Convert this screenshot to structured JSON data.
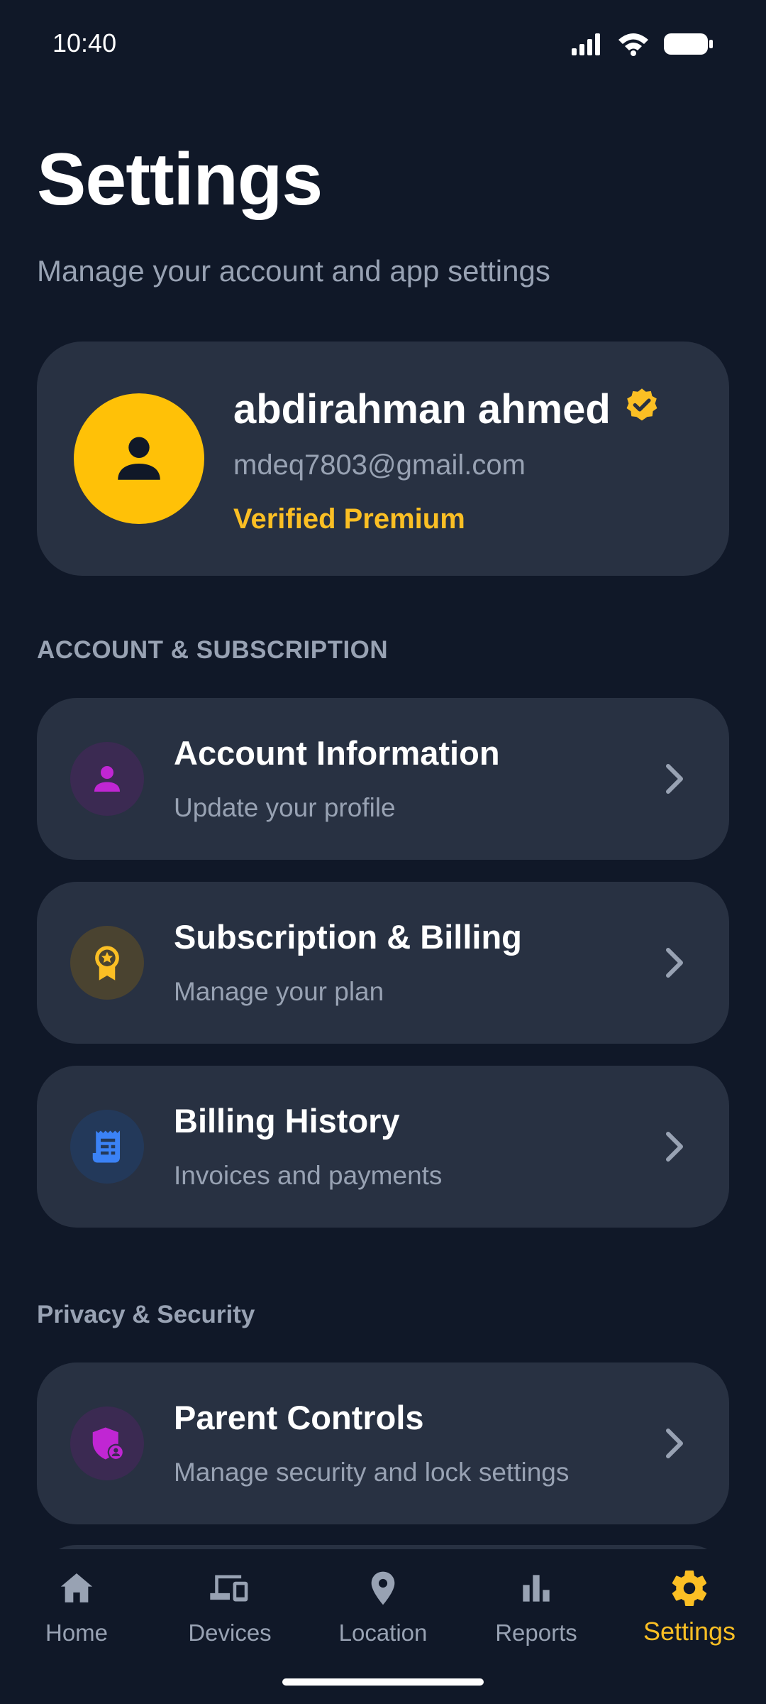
{
  "status_bar": {
    "time": "10:40"
  },
  "header": {
    "title": "Settings",
    "subtitle": "Manage your account and app settings"
  },
  "profile": {
    "name": "abdirahman ahmed",
    "email": "mdeq7803@gmail.com",
    "status": "Verified Premium",
    "avatar_icon": "person-icon",
    "badge_icon": "verified-badge-icon"
  },
  "sections": {
    "account": {
      "label": "ACCOUNT & SUBSCRIPTION",
      "items": [
        {
          "title": "Account Information",
          "subtitle": "Update your profile",
          "icon": "person-icon",
          "icon_color": "#c026d3",
          "icon_bg": "#3b2a52"
        },
        {
          "title": "Subscription & Billing",
          "subtitle": "Manage your plan",
          "icon": "award-icon",
          "icon_color": "#fbbf24",
          "icon_bg": "#4a4330"
        },
        {
          "title": "Billing History",
          "subtitle": "Invoices and payments",
          "icon": "receipt-icon",
          "icon_color": "#3b82f6",
          "icon_bg": "#23395a"
        }
      ]
    },
    "privacy": {
      "label": "Privacy & Security",
      "items": [
        {
          "title": "Parent Controls",
          "subtitle": "Manage security and lock settings",
          "icon": "shield-user-icon",
          "icon_color": "#c026d3",
          "icon_bg": "#3b2a52"
        }
      ]
    }
  },
  "bottom_nav": {
    "items": [
      {
        "label": "Home",
        "icon": "home-icon"
      },
      {
        "label": "Devices",
        "icon": "devices-icon"
      },
      {
        "label": "Location",
        "icon": "location-pin-icon"
      },
      {
        "label": "Reports",
        "icon": "bar-chart-icon"
      },
      {
        "label": "Settings",
        "icon": "gear-icon",
        "active": true
      }
    ]
  },
  "colors": {
    "background": "#101828",
    "card": "#283142",
    "accent": "#fbbf24",
    "muted_text": "#98a2b3"
  }
}
